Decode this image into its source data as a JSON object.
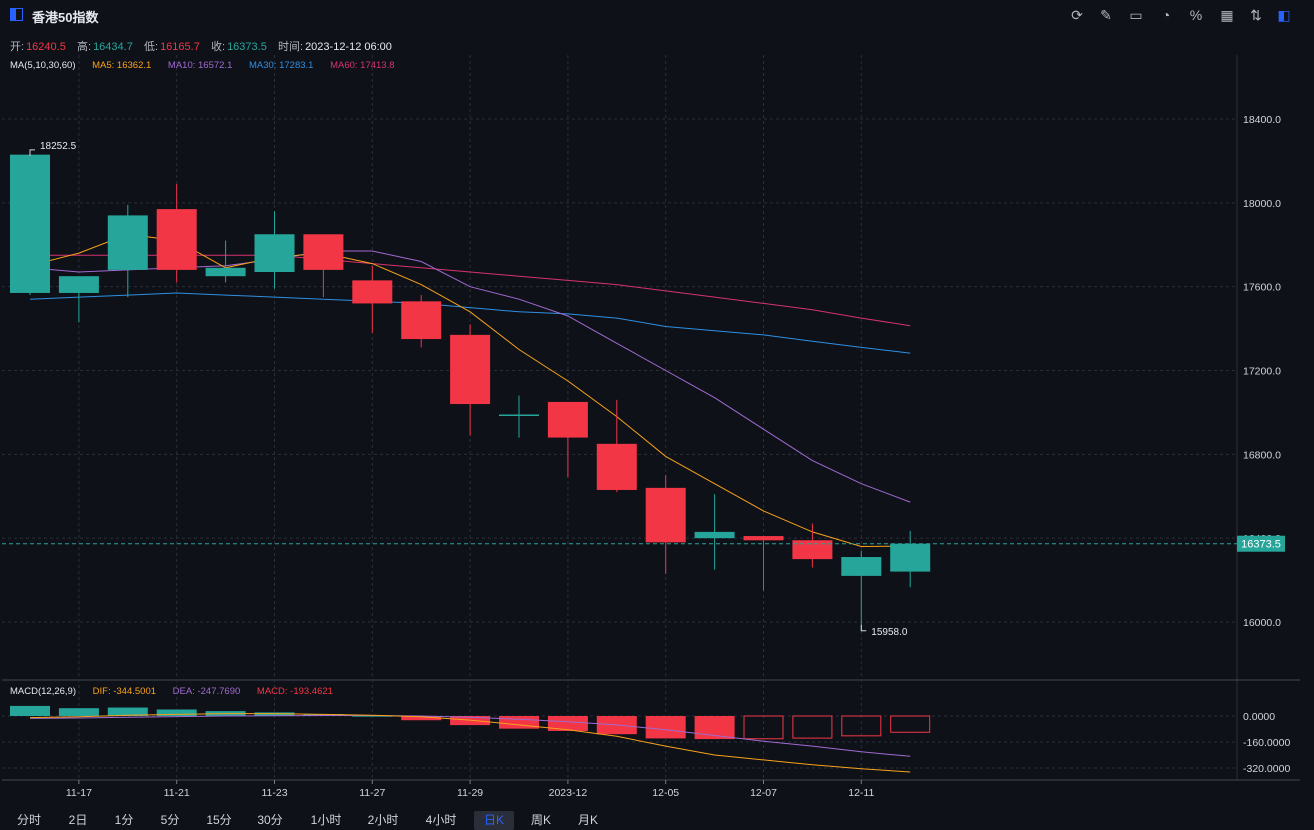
{
  "title": "香港50指数",
  "ohlc": {
    "open_label": "开:",
    "open": "16240.5",
    "high_label": "高:",
    "high": "16434.7",
    "low_label": "低:",
    "low": "16165.7",
    "close_label": "收:",
    "close": "16373.5",
    "time_label": "时间:",
    "time": "2023-12-12 06:00"
  },
  "ma_legend": {
    "name": "MA(5,10,30,60)",
    "ma5": "MA5: 16362.1",
    "ma10": "MA10: 16572.1",
    "ma30": "MA30: 17283.1",
    "ma60": "MA60: 17413.8"
  },
  "macd_legend": {
    "name": "MACD(12,26,9)",
    "dif": "DIF: -344.5001",
    "dea": "DEA: -247.7690",
    "macd": "MACD: -193.4621"
  },
  "toolbar_icons": [
    "refresh-icon",
    "draw-tools-icon",
    "chart-type-icon",
    "indicator-icon",
    "percent-icon",
    "layout-icon",
    "sort-icon",
    "panel-icon"
  ],
  "periods": [
    "分时",
    "2日",
    "1分",
    "5分",
    "15分",
    "30分",
    "1小时",
    "2小时",
    "4小时",
    "日K",
    "周K",
    "月K"
  ],
  "active_period": "日K",
  "colors": {
    "up": "#26a69a",
    "down": "#f23645",
    "ma5": "#f7a21b",
    "ma10": "#a06bd0",
    "ma30": "#2f8fe0",
    "ma60": "#d6336c",
    "bg": "#0f1119"
  },
  "chart_data": {
    "type": "candlestick",
    "x_ticks": [
      "11-17",
      "11-21",
      "11-23",
      "11-27",
      "11-29",
      "2023-12",
      "12-05",
      "12-07",
      "12-11"
    ],
    "y_ticks": [
      "18400.0",
      "18000.0",
      "17600.0",
      "17200.0",
      "16800.0",
      "16400.0",
      "16000.0"
    ],
    "ylim": [
      15700,
      18700
    ],
    "candles": [
      {
        "o": 17570,
        "h": 18252.5,
        "l": 17560,
        "c": 18230
      },
      {
        "o": 17570,
        "h": 17620,
        "l": 17430,
        "c": 17650
      },
      {
        "o": 17680,
        "h": 17990,
        "l": 17550,
        "c": 17940
      },
      {
        "o": 17970,
        "h": 18090,
        "l": 17620,
        "c": 17680
      },
      {
        "o": 17650,
        "h": 17820,
        "l": 17620,
        "c": 17690
      },
      {
        "o": 17670,
        "h": 17960,
        "l": 17590,
        "c": 17850
      },
      {
        "o": 17850,
        "h": 17850,
        "l": 17550,
        "c": 17680
      },
      {
        "o": 17630,
        "h": 17700,
        "l": 17380,
        "c": 17520
      },
      {
        "o": 17530,
        "h": 17560,
        "l": 17310,
        "c": 17350
      },
      {
        "o": 17370,
        "h": 17420,
        "l": 16890,
        "c": 17040
      },
      {
        "o": 16990,
        "h": 17080,
        "l": 16880,
        "c": 16990
      },
      {
        "o": 17050,
        "h": 17050,
        "l": 16690,
        "c": 16880
      },
      {
        "o": 16850,
        "h": 17060,
        "l": 16620,
        "c": 16630
      },
      {
        "o": 16640,
        "h": 16700,
        "l": 16230,
        "c": 16380
      },
      {
        "o": 16400,
        "h": 16610,
        "l": 16250,
        "c": 16430
      },
      {
        "o": 16410,
        "h": 16410,
        "l": 16150,
        "c": 16390
      },
      {
        "o": 16390,
        "h": 16470,
        "l": 16260,
        "c": 16300
      },
      {
        "o": 16220,
        "h": 16340,
        "l": 15958,
        "c": 16310
      },
      {
        "o": 16240.5,
        "h": 16434.7,
        "l": 16165.7,
        "c": 16373.5
      }
    ],
    "ma5": [
      17700,
      17760,
      17850,
      17820,
      17690,
      17740,
      17760,
      17710,
      17610,
      17480,
      17300,
      17150,
      16980,
      16790,
      16660,
      16530,
      16430,
      16360,
      16362.1
    ],
    "ma10": [
      17690,
      17670,
      17680,
      17690,
      17700,
      17730,
      17770,
      17770,
      17720,
      17600,
      17540,
      17460,
      17330,
      17200,
      17070,
      16920,
      16770,
      16660,
      16572.1
    ],
    "ma30": [
      17540,
      17550,
      17560,
      17570,
      17560,
      17550,
      17540,
      17530,
      17520,
      17500,
      17480,
      17470,
      17450,
      17410,
      17390,
      17370,
      17340,
      17310,
      17283.1
    ],
    "ma60": [
      17750,
      17750,
      17750,
      17750,
      17750,
      17750,
      17730,
      17710,
      17690,
      17670,
      17650,
      17630,
      17610,
      17580,
      17550,
      17520,
      17490,
      17450,
      17413.8
    ],
    "high_label": "18252.5",
    "low_label": "15958.0",
    "last_price": "16373.5",
    "macd": {
      "y_ticks": [
        "0.0000",
        "-160.0000",
        "-320.0000"
      ],
      "ylim": [
        -360,
        110
      ],
      "hist": [
        62,
        48,
        52,
        40,
        30,
        22,
        12,
        2,
        -26,
        -56,
        -78,
        -92,
        -112,
        -138,
        -142,
        -140,
        -136,
        -122,
        -100
      ],
      "dif": [
        -10,
        -5,
        5,
        10,
        15,
        15,
        10,
        5,
        -5,
        -25,
        -55,
        -85,
        -125,
        -185,
        -240,
        -270,
        -300,
        -325,
        -344.5
      ],
      "dea": [
        -15,
        -12,
        -8,
        -4,
        0,
        2,
        3,
        3,
        0,
        -8,
        -20,
        -35,
        -55,
        -85,
        -120,
        -155,
        -185,
        -220,
        -247.8
      ]
    }
  }
}
